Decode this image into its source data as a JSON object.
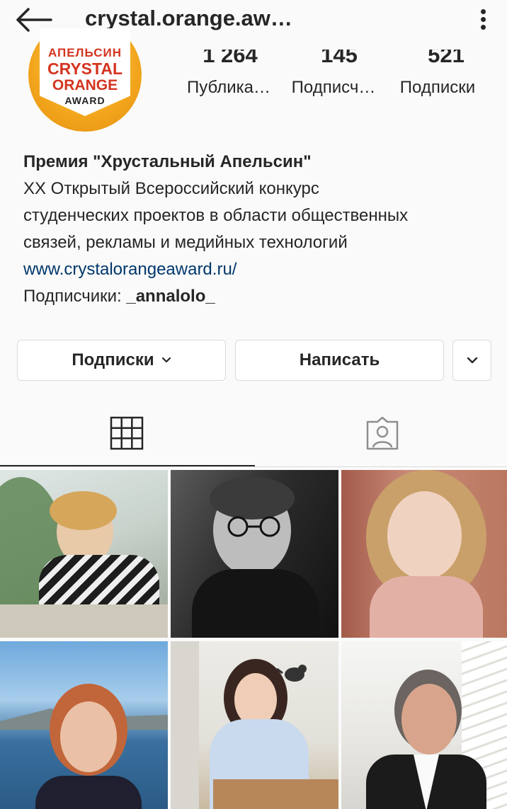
{
  "header": {
    "title": "crystal.orange.aw…",
    "back_icon": "arrow-left-icon",
    "more_icon": "kebab-menu-icon"
  },
  "profile": {
    "avatar_logo": {
      "line1": "АПЕЛЬСИН",
      "line2": "CRYSTAL",
      "line3": "ORANGE",
      "line4": "AWARD"
    },
    "stats": [
      {
        "value": "1 264",
        "label": "Публика…"
      },
      {
        "value": "145",
        "label": "Подписч…"
      },
      {
        "value": "521",
        "label": "Подписки"
      }
    ],
    "name": "Премия \"Хрустальный Апельсин\"",
    "bio_lines": [
      "XX Открытый Всероссийский конкурс",
      "студенческих проектов в области общественных",
      "связей, рекламы и медийных технологий"
    ],
    "link": "www.crystalorangeaward.ru/",
    "followers_prefix": "Подписчики: ",
    "followers_user": "_annalolo_"
  },
  "actions": {
    "following_label": "Подписки",
    "message_label": "Написать"
  },
  "tabs": {
    "grid_icon": "grid-icon",
    "tagged_icon": "tagged-person-icon"
  },
  "colors": {
    "link": "#00376b",
    "text": "#262626",
    "border": "#dbdbdb",
    "brand_red": "#d4341f",
    "brand_orange": "#f2a51c"
  }
}
